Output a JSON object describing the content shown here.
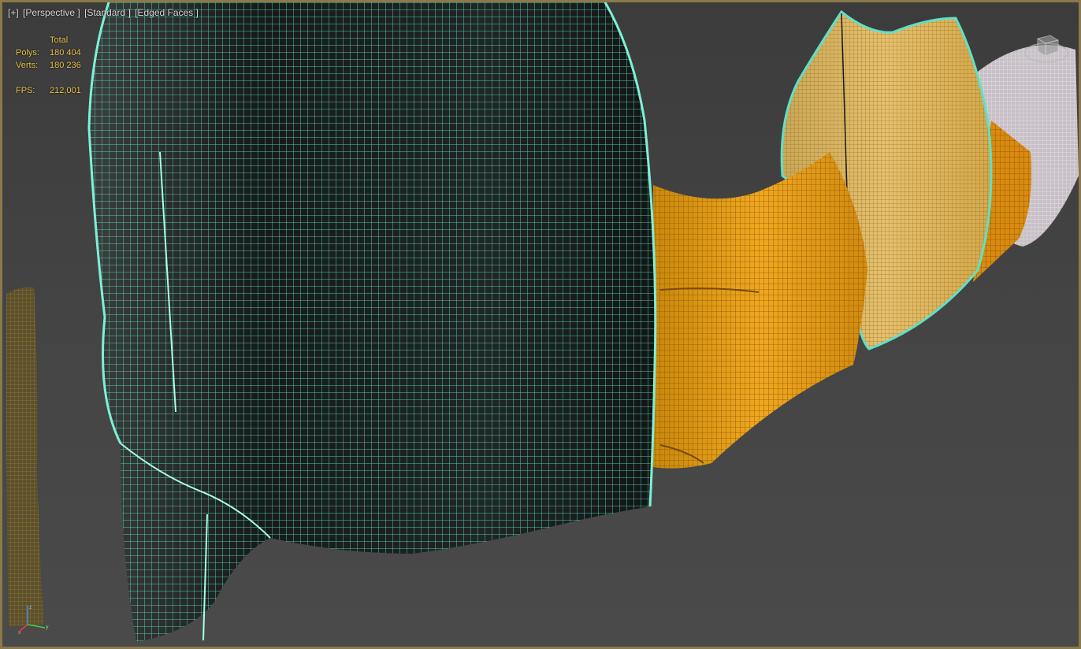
{
  "viewport": {
    "label_parts": [
      "[+]",
      "[Perspective ]",
      "[Standard ]",
      "[Edged Faces ]"
    ]
  },
  "stats": {
    "header": "Total",
    "polys_label": "Polys:",
    "polys_value": "180 404",
    "verts_label": "Verts:",
    "verts_value": "180 236",
    "fps_label": "FPS:",
    "fps_value": "212,001"
  },
  "viewcube": {
    "icon": "viewcube-icon"
  },
  "axis": {
    "x": "x",
    "y": "y",
    "z": "z"
  },
  "colors": {
    "wire_cyan": "#5fe0c8",
    "mesh_dark": "#1c2220",
    "mesh_orange": "#e09a18",
    "mesh_yellow": "#d9b85a",
    "stats_text": "#e6c34a",
    "border": "#8a7a4a"
  }
}
